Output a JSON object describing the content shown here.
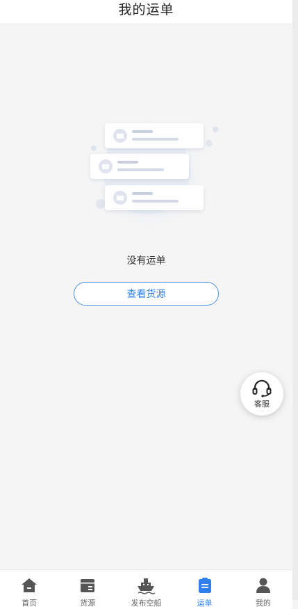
{
  "header": {
    "title": "我的运单"
  },
  "empty_state": {
    "message": "没有运单",
    "action_label": "查看货源"
  },
  "service": {
    "label": "客服"
  },
  "tabbar": {
    "active": "waybill",
    "active_color": "#2f80ed",
    "items": [
      {
        "label": "首页",
        "icon": "home-icon"
      },
      {
        "label": "货源",
        "icon": "cargo-box-icon"
      },
      {
        "label": "发布空船",
        "icon": "ship-icon"
      },
      {
        "label": "运单",
        "icon": "clipboard-icon"
      },
      {
        "label": "我的",
        "icon": "user-icon"
      }
    ]
  }
}
